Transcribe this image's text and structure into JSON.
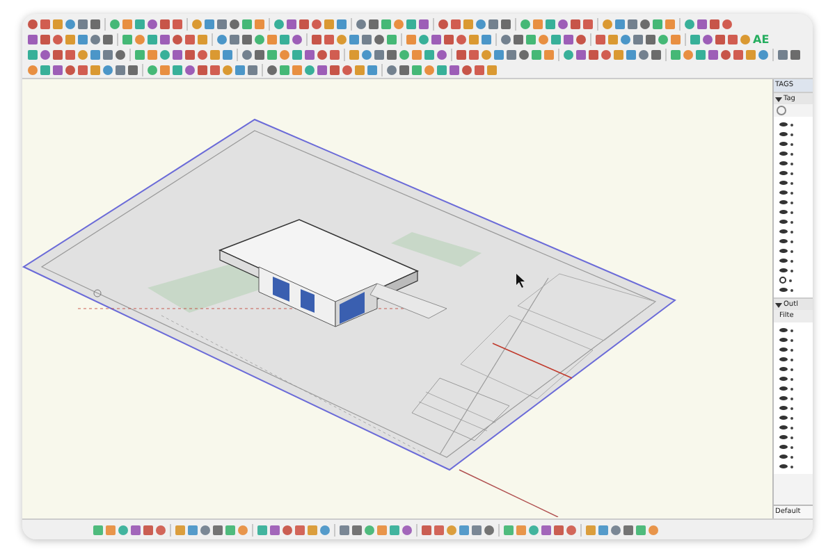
{
  "toolbar": {
    "label": "AE"
  },
  "tags_panel": {
    "title": "TAGS",
    "section": {
      "label": "Tag",
      "expanded": true
    },
    "rows": [
      {
        "visible": true
      },
      {
        "visible": true
      },
      {
        "visible": true
      },
      {
        "visible": true
      },
      {
        "visible": true
      },
      {
        "visible": true
      },
      {
        "visible": true
      },
      {
        "visible": true
      },
      {
        "visible": true
      },
      {
        "visible": true
      },
      {
        "visible": true
      },
      {
        "visible": true
      },
      {
        "visible": true
      },
      {
        "visible": true
      },
      {
        "visible": true
      },
      {
        "visible": true
      },
      {
        "visible": false
      },
      {
        "visible": true
      }
    ]
  },
  "outliner_panel": {
    "section": {
      "label": "Outl",
      "expanded": true
    },
    "filter_label": "Filte",
    "rows": [
      {
        "visible": true
      },
      {
        "visible": true
      },
      {
        "visible": true
      },
      {
        "visible": true
      },
      {
        "visible": true
      },
      {
        "visible": true
      },
      {
        "visible": true
      },
      {
        "visible": true
      },
      {
        "visible": true
      },
      {
        "visible": true
      },
      {
        "visible": true
      },
      {
        "visible": true
      },
      {
        "visible": true
      },
      {
        "visible": true
      },
      {
        "visible": true
      }
    ]
  },
  "panel_footer": {
    "label": "Default"
  }
}
